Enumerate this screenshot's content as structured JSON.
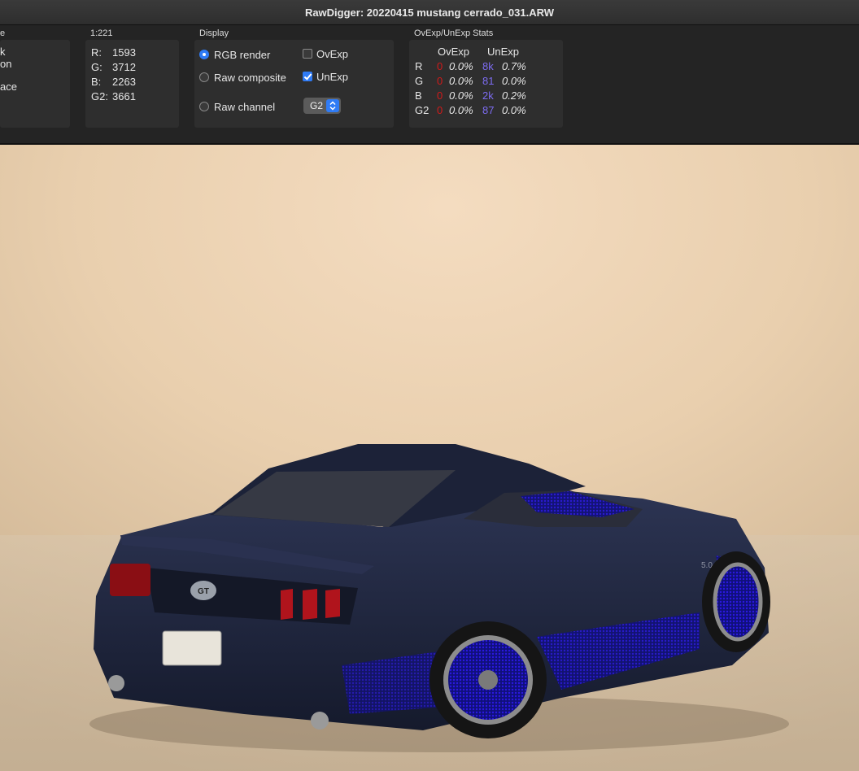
{
  "window": {
    "title": "RawDigger: 20220415 mustang cerrado_031.ARW"
  },
  "left_panel": {
    "header": "e",
    "items": [
      "k",
      "on",
      "ace"
    ]
  },
  "values_panel": {
    "header": "1:221",
    "rows": [
      {
        "label": "R:",
        "value": "1593"
      },
      {
        "label": "G:",
        "value": "3712"
      },
      {
        "label": "B:",
        "value": "2263"
      },
      {
        "label": "G2:",
        "value": "3661"
      }
    ]
  },
  "display_panel": {
    "header": "Display",
    "rgb_render": "RGB render",
    "raw_composite": "Raw composite",
    "raw_channel": "Raw channel",
    "ovexp": "OvExp",
    "unexp": "UnExp",
    "channel_select": "G2",
    "selected_mode": "RGB render",
    "ovexp_checked": false,
    "unexp_checked": true
  },
  "stats_panel": {
    "header": "OvExp/UnExp Stats",
    "col_ovexp": "OvExp",
    "col_unexp": "UnExp",
    "rows": [
      {
        "ch": "R",
        "ov_count": "0",
        "ov_pct": "0.0%",
        "un_count": "8k",
        "un_pct": "0.7%"
      },
      {
        "ch": "G",
        "ov_count": "0",
        "ov_pct": "0.0%",
        "un_count": "81",
        "un_pct": "0.0%"
      },
      {
        "ch": "B",
        "ov_count": "0",
        "ov_pct": "0.0%",
        "un_count": "2k",
        "un_pct": "0.2%"
      },
      {
        "ch": "G2",
        "ov_count": "0",
        "ov_pct": "0.0%",
        "un_count": "87",
        "un_pct": "0.0%"
      }
    ]
  },
  "image": {
    "badge": "GT",
    "rear_emblem": "5.0"
  },
  "colors": {
    "accent": "#2f7bf5",
    "ovexp": "#d21a1a",
    "unexp": "#7d6cf2",
    "car_body": "#1f2740",
    "unexp_overlay": "#1a10c8"
  }
}
